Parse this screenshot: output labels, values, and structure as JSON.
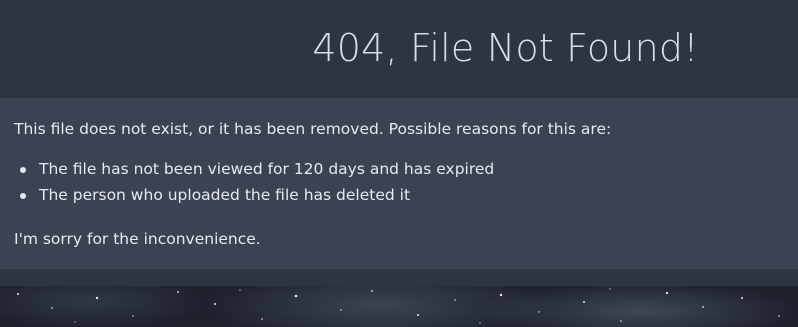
{
  "header": {
    "title": "404, File Not Found!"
  },
  "message": {
    "intro": "This file does not exist, or it has been removed. Possible reasons for this are:",
    "reasons": [
      "The file has not been viewed for 120 days and has expired",
      "The person who uploaded the file has deleted it"
    ],
    "closing": "I'm sorry for the inconvenience."
  },
  "colors": {
    "header_background": "#2e3440",
    "content_background": "#3b4252",
    "text": "#e5e9f0"
  }
}
